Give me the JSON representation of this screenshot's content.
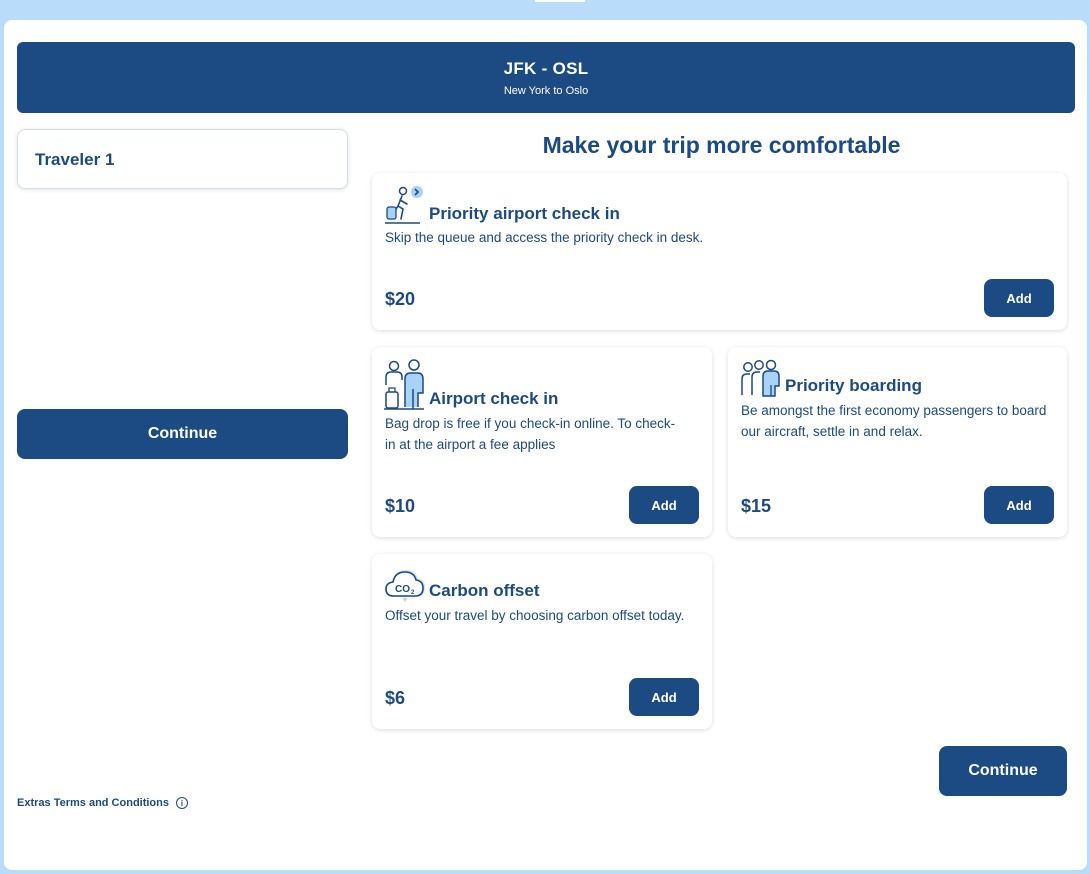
{
  "header": {
    "route_code": "JFK - OSL",
    "route_name": "New York to Oslo"
  },
  "traveler": {
    "label": "Traveler 1"
  },
  "section_title": "Make your trip more comfortable",
  "extras": [
    {
      "title": "Priority airport check in",
      "description": "Skip the queue and access the priority check in desk.",
      "price": "$20",
      "button": "Add",
      "icon": "priority-checkin-icon"
    },
    {
      "title": "Airport check in",
      "description": "Bag drop is free if you check-in online. To check-in at the airport a fee applies",
      "price": "$10",
      "button": "Add",
      "icon": "airport-checkin-icon"
    },
    {
      "title": "Priority boarding",
      "description": "Be amongst the first economy passengers to board our aircraft, settle in and relax.",
      "price": "$15",
      "button": "Add",
      "icon": "priority-boarding-icon"
    },
    {
      "title": "Carbon offset",
      "description": "Offset your travel by choosing carbon offset today.",
      "price": "$6",
      "button": "Add",
      "icon": "carbon-offset-icon"
    }
  ],
  "actions": {
    "continue_label": "Continue"
  },
  "footer": {
    "terms_label": "Extras Terms and Conditions",
    "info_glyph": "i"
  },
  "colors": {
    "brand": "#1c4a82",
    "background": "#b9dcfb",
    "icon_accent": "#a9d2f7"
  }
}
